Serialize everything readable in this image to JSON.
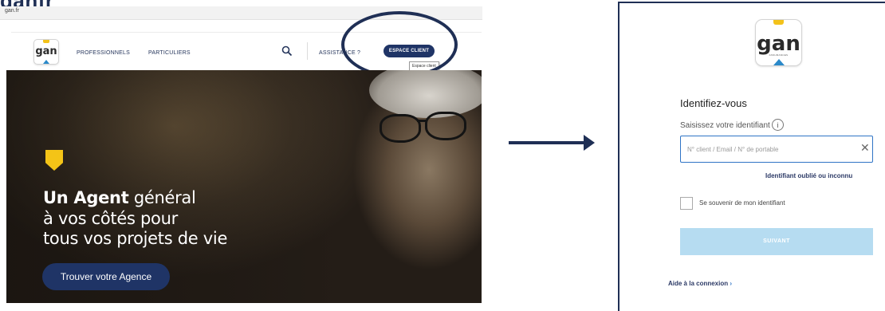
{
  "browser": {
    "clipped_title": "ganfr",
    "url": "gan.fr"
  },
  "nav": {
    "logo_text": "gan",
    "professionals": "PROFESSIONNELS",
    "individuals": "PARTICULIERS",
    "assistance": "ASSISTANCE ?",
    "client_space_button": "ESPACE CLIENT",
    "client_space_tooltip": "Espace client"
  },
  "hero": {
    "line1_bold": "Un Agent",
    "line1_rest": " général",
    "line2": "à vos côtés pour",
    "line3": "tous vos projets de vie",
    "cta": "Trouver votre Agence"
  },
  "login": {
    "logo_text": "gan",
    "logo_subtext": "ASSURANCES",
    "heading": "Identifiez-vous",
    "id_label": "Saisissez votre identifiant",
    "info_icon_glyph": "i",
    "id_placeholder": "N° client / Email / N° de portable",
    "clear_glyph": "✕",
    "forgot_link": "Identifiant oublié ou inconnu",
    "remember_label": "Se souvenir de mon identifiant",
    "submit_label": "SUIVANT",
    "help_link": "Aide à la connexion",
    "help_chevron": "›"
  },
  "colors": {
    "brand_navy": "#1f3466",
    "brand_yellow": "#f4c417",
    "brand_blue": "#2a89c9",
    "submit_disabled": "#b6dcf1",
    "input_focus": "#2f74c6"
  },
  "icons": [
    "search-icon",
    "info-icon",
    "clear-icon",
    "arrow-right-icon",
    "gan-logo"
  ]
}
